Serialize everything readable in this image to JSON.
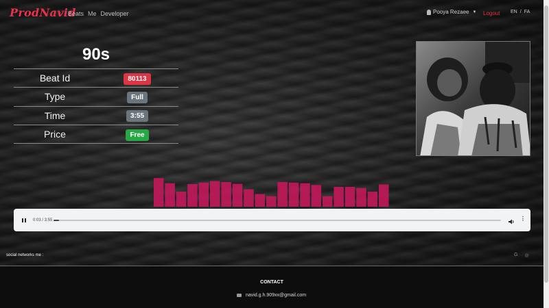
{
  "nav": {
    "brand": "ProdNavid",
    "links": [
      "Beats",
      "Me",
      "Developer"
    ],
    "user": "Pooya Rezaee",
    "logout": "Logout",
    "lang_en": "EN",
    "lang_sep": "/",
    "lang_fa": "FA"
  },
  "beat": {
    "title": "90s",
    "rows": [
      {
        "label": "Beat Id",
        "value": "80113",
        "badge_color": "#dc3545"
      },
      {
        "label": "Type",
        "value": "Full",
        "badge_color": "#6c757d"
      },
      {
        "label": "Time",
        "value": "3:55",
        "badge_color": "#6c757d"
      },
      {
        "label": "Price",
        "value": "Free",
        "badge_color": "#28a745"
      }
    ]
  },
  "visualizer": {
    "levels": [
      0.95,
      0.78,
      0.5,
      0.75,
      0.8,
      0.85,
      0.82,
      0.76,
      0.58,
      0.42,
      0.35,
      0.82,
      0.8,
      0.78,
      0.72,
      0.35,
      0.66,
      0.66,
      0.62,
      0.5,
      0.74
    ],
    "color": "#c2185b"
  },
  "player": {
    "time": "0:03 / 3:55",
    "progress": 0.013
  },
  "footer": {
    "social_label": "social networks me :",
    "contact": "CONTACT",
    "email": "navid.g.h.909xx@gmail.com"
  },
  "colors": {
    "accent": "#e8324a"
  }
}
